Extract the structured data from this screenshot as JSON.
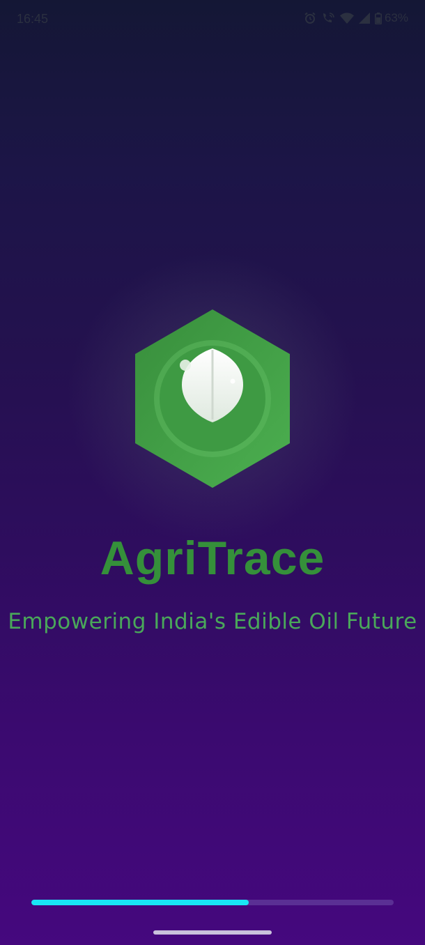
{
  "status_bar": {
    "time": "16:45",
    "battery_percent": "63%",
    "icons": [
      "alarm-icon",
      "wifi-calling-icon",
      "wifi-icon",
      "cellular-signal-icon",
      "battery-icon"
    ]
  },
  "splash": {
    "app_name": "AgriTrace",
    "tagline": "Empowering India's Edible Oil Future",
    "logo_icon": "leaf-hexagon-logo",
    "loading_progress": 0.6
  },
  "colors": {
    "brand_green": "#35903a",
    "tagline_green": "#4aa85a",
    "hexagon_green": "#43a047",
    "progress_fill": "#19e6f5",
    "progress_track": "#5a2f94",
    "background_top": "#141735",
    "background_bottom": "#45087e"
  }
}
